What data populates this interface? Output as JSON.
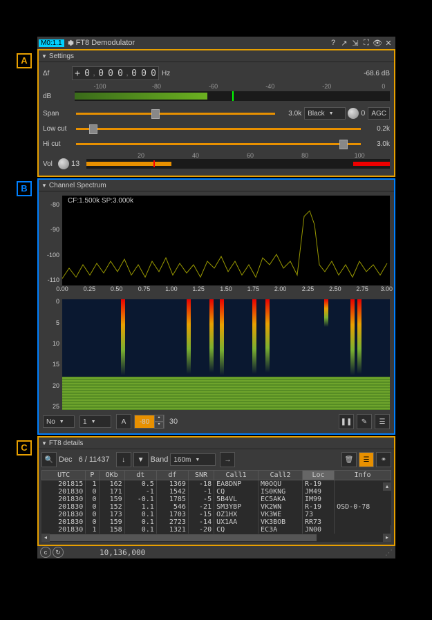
{
  "titlebar": {
    "tag": "M0:1.1",
    "title": "FT8 Demodulator"
  },
  "settings": {
    "title": "Settings",
    "df_label": "Δf",
    "df_sign": "+",
    "df_digits": [
      "0",
      "0",
      "0",
      "0",
      "0",
      "0",
      "0"
    ],
    "df_unit": "Hz",
    "db_value": "-68.6 dB",
    "db_label": "dB",
    "db_ticks": [
      "-100",
      "-80",
      "-60",
      "-40",
      "-20",
      "0"
    ],
    "span_label": "Span",
    "span_value": "3.0k",
    "colormap": "Black",
    "agc_val": "0",
    "agc_label": "AGC",
    "low_cut_label": "Low cut",
    "low_cut_value": "0.2k",
    "hi_cut_label": "Hi cut",
    "hi_cut_value": "3.0k",
    "vol_label": "Vol",
    "vol_value": "13",
    "vol_ticks": [
      "20",
      "40",
      "60",
      "80",
      "100"
    ]
  },
  "spectrum": {
    "title": "Channel Spectrum",
    "info": "CF:1.500k SP:3.000k",
    "yticks": [
      "-80",
      "-90",
      "-100",
      "-110"
    ],
    "xticks": [
      "0.00",
      "0.25",
      "0.50",
      "0.75",
      "1.00",
      "1.25",
      "1.50",
      "1.75",
      "2.00",
      "2.25",
      "2.50",
      "2.75",
      "3.00"
    ],
    "wf_yticks": [
      "0",
      "5",
      "10",
      "15",
      "20",
      "25"
    ],
    "combo1": "No",
    "combo2": "1",
    "a_btn": "A",
    "spin1": "-80",
    "spin2": "30"
  },
  "ft8": {
    "title": "FT8 details",
    "dec_label": "Dec",
    "dec_count": "6 / 11437",
    "band_label": "Band",
    "band_value": "160m",
    "headers": [
      "UTC",
      "P",
      "OKb",
      "dt",
      "df",
      "SNR",
      "Call1",
      "Call2",
      "Loc",
      "Info"
    ],
    "rows": [
      {
        "utc": "201815",
        "p": "1",
        "ok": "162",
        "dt": "0.5",
        "df": "1369",
        "snr": "-18",
        "c1": "EA8DNP",
        "c2": "M0OQU",
        "loc": "R-19",
        "info": ""
      },
      {
        "utc": "201830",
        "p": "0",
        "ok": "171",
        "dt": "-1",
        "df": "1542",
        "snr": "-1",
        "c1": "CQ",
        "c2": "IS0KNG",
        "loc": "JM49",
        "info": ""
      },
      {
        "utc": "201830",
        "p": "0",
        "ok": "159",
        "dt": "-0.1",
        "df": "1785",
        "snr": "-5",
        "c1": "5B4VL",
        "c2": "EC5AKA",
        "loc": "IM99",
        "info": ""
      },
      {
        "utc": "201830",
        "p": "0",
        "ok": "152",
        "dt": "1.1",
        "df": "546",
        "snr": "-21",
        "c1": "SM3YBP",
        "c2": "VK2WN",
        "loc": "R-19",
        "info": "OSD-0-78"
      },
      {
        "utc": "201830",
        "p": "0",
        "ok": "173",
        "dt": "0.1",
        "df": "1703",
        "snr": "-15",
        "c1": "OZ1HX",
        "c2": "VK3WE",
        "loc": "73",
        "info": ""
      },
      {
        "utc": "201830",
        "p": "0",
        "ok": "159",
        "dt": "0.1",
        "df": "2723",
        "snr": "-14",
        "c1": "UX1AA",
        "c2": "VK3BOB",
        "loc": "RR73",
        "info": ""
      },
      {
        "utc": "201830",
        "p": "1",
        "ok": "158",
        "dt": "0.1",
        "df": "1321",
        "snr": "-20",
        "c1": "CQ",
        "c2": "EC3A",
        "loc": "JN00",
        "info": ""
      }
    ]
  },
  "status": {
    "freq": "10,136,000"
  },
  "labels": {
    "a": "A",
    "b": "B",
    "c": "C"
  }
}
